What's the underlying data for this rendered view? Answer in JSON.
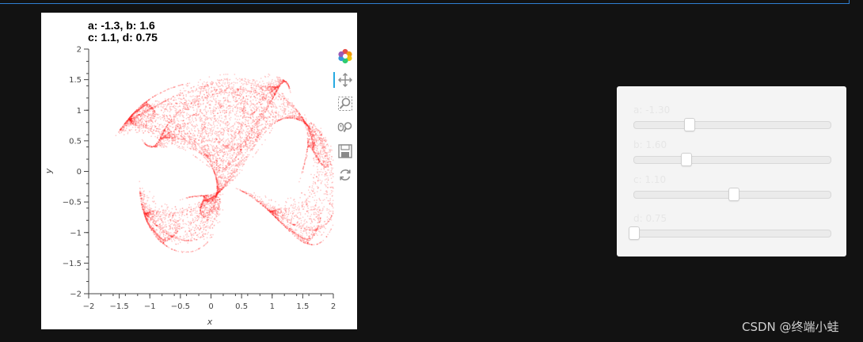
{
  "plot": {
    "title_line1": "a: -1.3, b: 1.6",
    "title_line2": "c: 1.1, d: 0.75"
  },
  "chart_data": {
    "type": "scatter",
    "title": "a: -1.3, b: 1.6\nc: 1.1, d: 0.75",
    "xlabel": "x",
    "ylabel": "y",
    "xlim": [
      -2,
      2
    ],
    "ylim": [
      -2,
      2
    ],
    "x_ticks": [
      "−2",
      "−1.5",
      "−1",
      "−0.5",
      "0",
      "0.5",
      "1",
      "1.5",
      "2"
    ],
    "y_ticks": [
      "2",
      "1.5",
      "1",
      "0.5",
      "0",
      "−0.5",
      "−1",
      "−1.5",
      "−2"
    ],
    "grid": false,
    "point_color": "#ff0000",
    "params": {
      "a": -1.3,
      "b": 1.6,
      "c": 1.1,
      "d": 0.75
    }
  },
  "toolbar": {
    "tools": [
      "bokeh-logo-icon",
      "pan-icon",
      "box-zoom-icon",
      "wheel-zoom-icon",
      "save-icon",
      "reset-icon"
    ]
  },
  "sliders": [
    {
      "label": "a: -1.30",
      "min": -3,
      "max": 3,
      "value": -1.3
    },
    {
      "label": "b: 1.60",
      "min": 0,
      "max": 6,
      "value": 1.6
    },
    {
      "label": "c: 1.10",
      "min": -4,
      "max": 6,
      "value": 1.1
    },
    {
      "label": "d: 0.75",
      "min": 0.75,
      "max": 3,
      "value": 0.75
    }
  ],
  "watermark": "CSDN @终端小蛙"
}
